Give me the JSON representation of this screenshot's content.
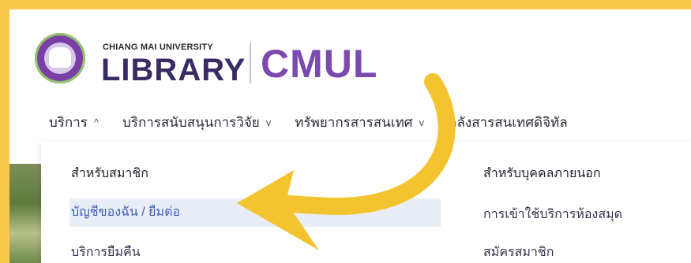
{
  "header": {
    "university": "CHIANG MAI UNIVERSITY",
    "library": "LIBRARY",
    "brand": "CMUL"
  },
  "nav": [
    {
      "label": "บริการ",
      "chevron": "^"
    },
    {
      "label": "บริการสนับสนุนการวิจัย",
      "chevron": "v"
    },
    {
      "label": "ทรัพยากรสารสนเทศ",
      "chevron": "v"
    },
    {
      "label": "คลังสารสนเทศดิจิทัล",
      "chevron": ""
    }
  ],
  "dropdown": {
    "members": {
      "title": "สำหรับสมาชิก",
      "items": [
        "บัญชีของฉัน / ยืมต่อ",
        "บริการยืมคืน"
      ]
    },
    "external": {
      "title": "สำหรับบุคคลภายนอก",
      "items": [
        "การเข้าใช้บริการห้องสมุด",
        "สมัครสมาชิก"
      ]
    }
  },
  "colors": {
    "background": "#f8c94a",
    "arrow": "#f4c430",
    "active_bg": "#e8edf6",
    "active_text": "#3f5fb8",
    "brand": "#7a4ab0"
  }
}
